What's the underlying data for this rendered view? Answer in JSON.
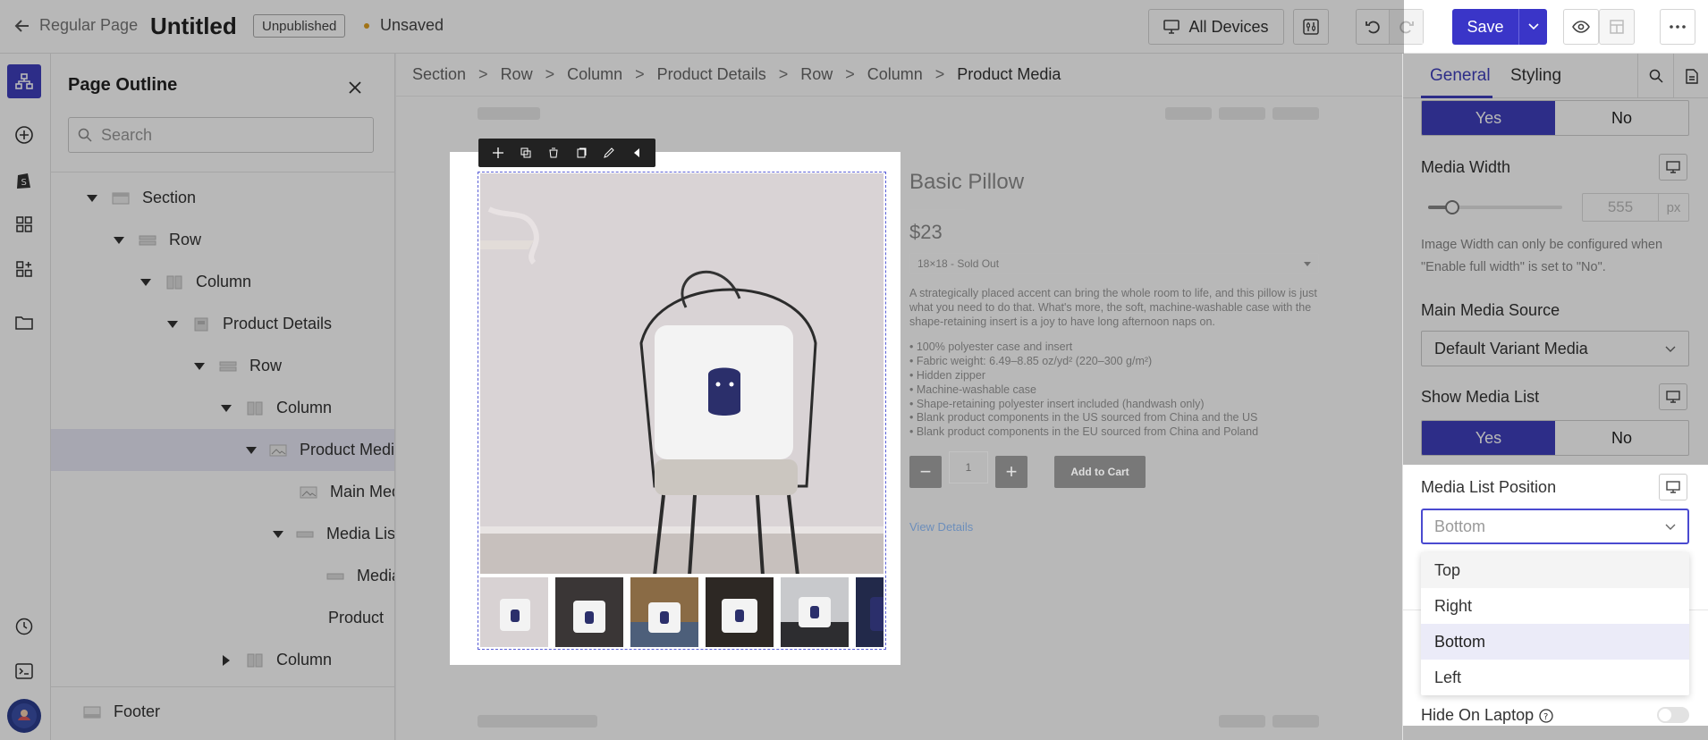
{
  "topbar": {
    "back_label": "Regular Page",
    "page_title": "Untitled",
    "publish_status": "Unpublished",
    "save_status": "Unsaved",
    "devices_label": "All Devices",
    "save_label": "Save"
  },
  "outline": {
    "title": "Page Outline",
    "search_placeholder": "Search",
    "items": [
      {
        "label": "Section"
      },
      {
        "label": "Row"
      },
      {
        "label": "Column"
      },
      {
        "label": "Product Details"
      },
      {
        "label": "Row"
      },
      {
        "label": "Column"
      },
      {
        "label": "Product Media"
      },
      {
        "label": "Main Media"
      },
      {
        "label": "Media List"
      },
      {
        "label": "Media"
      },
      {
        "label": "Product"
      },
      {
        "label": "Column"
      },
      {
        "label": "Footer"
      }
    ]
  },
  "breadcrumb": [
    "Section",
    "Row",
    "Column",
    "Product Details",
    "Row",
    "Column",
    "Product Media"
  ],
  "product": {
    "title": "Basic Pillow",
    "price": "$23",
    "variant": "18×18 - Sold Out",
    "description": "A strategically placed accent can bring the whole room to life, and this pillow is just what you need to do that. What's more, the soft, machine-washable case with the shape-retaining insert is a joy to have long afternoon naps on.",
    "bullets": [
      "• 100% polyester case and insert",
      "• Fabric weight: 6.49–8.85 oz/yd² (220–300 g/m²)",
      "• Hidden zipper",
      "• Machine-washable case",
      "• Shape-retaining polyester insert included (handwash only)",
      "• Blank product components in the US sourced from China and the US",
      "• Blank product components in the EU sourced from China and Poland"
    ],
    "quantity": "1",
    "minus": "−",
    "plus": "+",
    "add_to_cart": "Add to Cart",
    "view_details": "View Details"
  },
  "panel": {
    "tab_general": "General",
    "tab_styling": "Styling",
    "yes": "Yes",
    "no": "No",
    "media_width_label": "Media Width",
    "media_width_value": "555",
    "media_width_unit": "px",
    "media_width_slider": 0.18,
    "media_width_hint": "Image Width can only be configured when \"Enable full width\" is set to \"No\".",
    "main_media_source_label": "Main Media Source",
    "main_media_source_value": "Default Variant Media",
    "show_media_list_label": "Show Media List",
    "media_list_position_label": "Media List Position",
    "media_list_position_value": "Bottom",
    "options": [
      "Top",
      "Right",
      "Bottom",
      "Left"
    ],
    "selected_option": "Bottom",
    "hide_on_laptop_label": "Hide On Laptop"
  },
  "colors": {
    "accent": "#3f3fbd",
    "save_button": "#3a35c8",
    "unsaved_dot": "#e0a020"
  }
}
